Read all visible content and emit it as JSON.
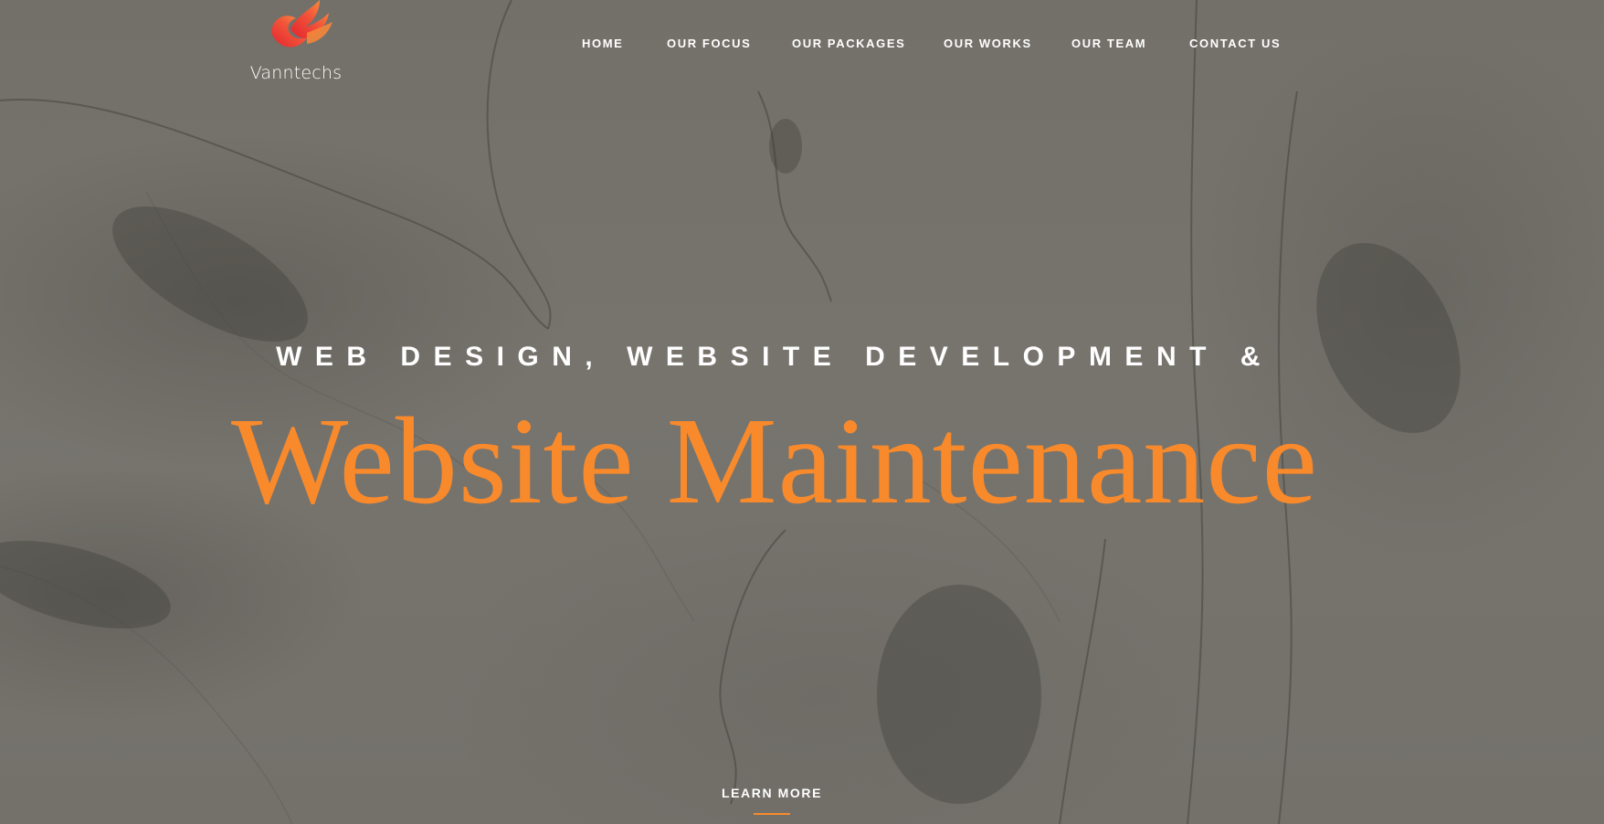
{
  "brand": {
    "name": "Vanntechs",
    "logo_icon": "flame-bird-icon",
    "accent_color": "#f98a2c"
  },
  "nav": {
    "items": [
      {
        "label": "HOME"
      },
      {
        "label": "OUR FOCUS"
      },
      {
        "label": "OUR PACKAGES"
      },
      {
        "label": "OUR WORKS"
      },
      {
        "label": "OUR TEAM"
      },
      {
        "label": "CONTACT US"
      }
    ]
  },
  "hero": {
    "subtitle": "WEB DESIGN, WEBSITE DEVELOPMENT &",
    "title": "Website Maintenance",
    "cta_label": "LEARN MORE"
  }
}
